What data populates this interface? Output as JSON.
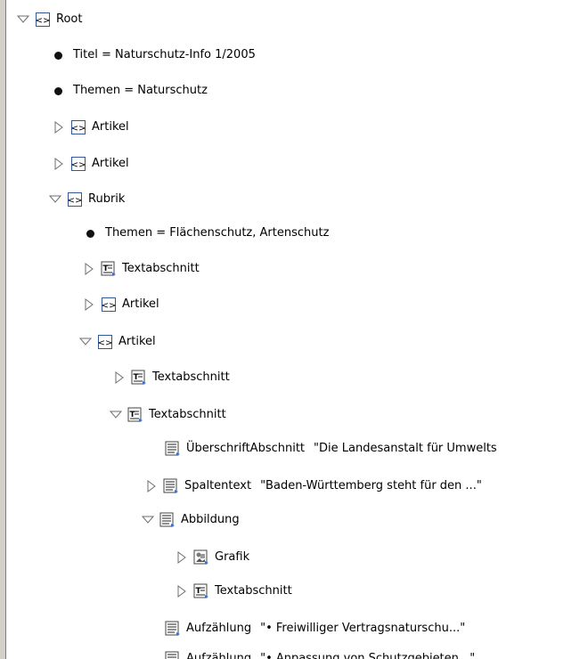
{
  "tree": {
    "nodes": [
      {
        "label": "Root",
        "value": ""
      },
      {
        "label": "Titel = Naturschutz-Info 1/2005",
        "value": ""
      },
      {
        "label": "Themen = Naturschutz",
        "value": ""
      },
      {
        "label": "Artikel",
        "value": ""
      },
      {
        "label": "Artikel",
        "value": ""
      },
      {
        "label": "Rubrik",
        "value": ""
      },
      {
        "label": "Themen = Flächenschutz, Artenschutz",
        "value": ""
      },
      {
        "label": "Textabschnitt",
        "value": ""
      },
      {
        "label": "Artikel",
        "value": ""
      },
      {
        "label": "Artikel",
        "value": ""
      },
      {
        "label": "Textabschnitt",
        "value": ""
      },
      {
        "label": "Textabschnitt",
        "value": ""
      },
      {
        "label": "ÜberschriftAbschnitt",
        "value": "\"Die Landesanstalt für Umwelts"
      },
      {
        "label": "Spaltentext",
        "value": "\"Baden-Württemberg steht für den ...\""
      },
      {
        "label": "Abbildung",
        "value": ""
      },
      {
        "label": "Grafik",
        "value": ""
      },
      {
        "label": "Textabschnitt",
        "value": ""
      },
      {
        "label": "Aufzählung",
        "value": "\"• Freiwilliger Vertragsnaturschu...\""
      },
      {
        "label": "Aufzählung",
        "value": "\"• Anpassung von Schutzgebieten...\""
      }
    ]
  },
  "icons": {
    "element": "xml-element-icon",
    "text": "text-frame-icon",
    "paragraph": "paragraph-icon",
    "graphic": "graphic-icon",
    "attribute": "attribute-dot-icon"
  },
  "colors": {
    "icon_border": "#335599",
    "twisty": "#7a7a7a",
    "badge": "#3a6fc7"
  }
}
